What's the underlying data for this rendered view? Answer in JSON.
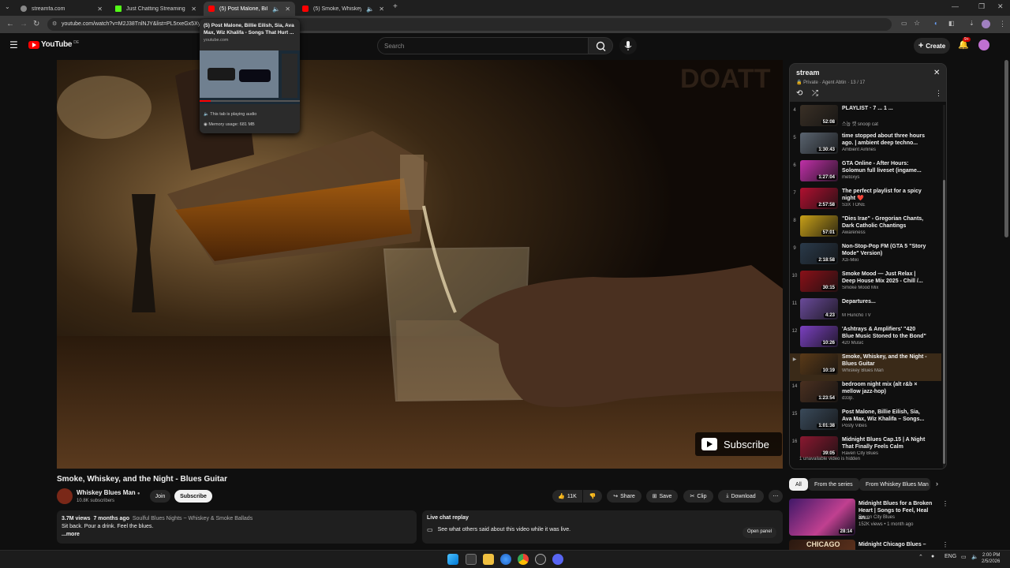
{
  "browser": {
    "tabs": [
      {
        "title": "streamfa.com",
        "color": "#888888"
      },
      {
        "title": "Just Chatting Streaming - Live",
        "color": "#53fc18"
      },
      {
        "title": "(5) Post Malone, Billie Eilish",
        "color": "#ff0000"
      },
      {
        "title": "(5) Smoke, Whiskey, and the",
        "color": "#ff0000"
      }
    ],
    "url": "youtube.com/watch?v=M2J38TnlNJY&list=PL5rxeGx5Xy"
  },
  "hover_card": {
    "title": "(5) Post Malone, Billie Eilish, Sia, Ava Max, Wiz Khalifa - Songs That Hurt ...",
    "domain": "youtube.com",
    "audio": "This tab is playing audio",
    "memory": "Memory usage: 681 MB"
  },
  "masthead": {
    "logo": "YouTube",
    "region": "DE",
    "search_placeholder": "Search",
    "create_label": "Create",
    "notif_count": "9+"
  },
  "video": {
    "watermark": "DOATT",
    "subscribe_overlay": "Subscribe",
    "title": "Smoke, Whiskey, and the Night - Blues Guitar",
    "channel": "Whiskey Blues Man",
    "subscribers": "10.8K subscribers",
    "join_label": "Join",
    "subscribe_label": "Subscribe",
    "likes": "11K",
    "share_label": "Share",
    "save_label": "Save",
    "clip_label": "Clip",
    "download_label": "Download"
  },
  "description": {
    "views": "3.7M views",
    "age": "7 months ago",
    "tags": "Soulful Blues Nights ~ Whiskey & Smoke Ballads",
    "text": "Sit back. Pour a drink. Feel the blues.",
    "more": "...more"
  },
  "chat_replay": {
    "title": "Live chat replay",
    "text": "See what others said about this video while it was live.",
    "button": "Open panel"
  },
  "playlist": {
    "title": "stream",
    "meta": "Private · Agent Abtin · 13 / 17",
    "items": [
      {
        "idx": "4",
        "title": "PLAYLIST · 7 ... 1 ...",
        "channel": "스눕 캣 snoop cat",
        "dur": "52:08",
        "color": "#3a3026"
      },
      {
        "idx": "5",
        "title": "time stopped about three hours ago. | ambient deep techno...",
        "channel": "Ambient Airlines",
        "dur": "1:30:43",
        "color": "#5a6470"
      },
      {
        "idx": "6",
        "title": "GTA Online - After Hours: Solomun full liveset (ingame...",
        "channel": "metoxys",
        "dur": "1:27:04",
        "color": "#c030a8"
      },
      {
        "idx": "7",
        "title": "The perfect playlist for a spicy night ❤️",
        "channel": "S3X TONE",
        "dur": "2:57:58",
        "color": "#b01030"
      },
      {
        "idx": "8",
        "title": "\"Dies Irae\" - Gregorian Chants, Dark Catholic Chantings",
        "channel": "Awareness",
        "dur": "57:01",
        "color": "#c8a018"
      },
      {
        "idx": "9",
        "title": "Non-Stop-Pop FM (GTA 5 \"Story Mode\" Version)",
        "channel": "Xzi-Mixi",
        "dur": "2:18:58",
        "color": "#2a3a4a"
      },
      {
        "idx": "10",
        "title": "Smoke Mood — Just Relax | Deep House Mix 2025 - Chill /...",
        "channel": "Smoke Mood Mix",
        "dur": "30:15",
        "color": "#8a1018"
      },
      {
        "idx": "11",
        "title": "Departures...",
        "channel": "M Huncho TV",
        "dur": "4:23",
        "color": "#6a4a9a"
      },
      {
        "idx": "12",
        "title": "'Ashtrays & Amplifiers' \"420 Blue Music Stoned to the Bond\"",
        "channel": "420 Music",
        "dur": "10:26",
        "color": "#7a40c0"
      },
      {
        "idx": "▶",
        "title": "Smoke, Whiskey, and the Night - Blues Guitar",
        "channel": "Whiskey Blues Man",
        "dur": "10:19",
        "color": "#5a3a18"
      },
      {
        "idx": "14",
        "title": "bedroom night mix (alt r&b × mellow jazz-hop)",
        "channel": "d33p.",
        "dur": "1:23:54",
        "color": "#4a3020"
      },
      {
        "idx": "15",
        "title": "Post Malone, Billie Eilish, Sia, Ava Max, Wiz Khalifa – Songs...",
        "channel": "Posty Vibes",
        "dur": "1:01:38",
        "color": "#3a4a5a"
      },
      {
        "idx": "16",
        "title": "Midnight Blues Cap.15 | A Night That Finally Feels Calm",
        "channel": "Raven City Blues",
        "dur": "39:05",
        "color": "#8a1830"
      }
    ],
    "hidden_note": "1 unavailable video is hidden"
  },
  "chips": [
    "All",
    "From the series",
    "From Whiskey Blues Man"
  ],
  "recommendations": [
    {
      "title": "Midnight Blues for a Broken Heart | Songs to Feel, Heal an...",
      "channel": "Raven City Blues",
      "meta": "152K views • 1 month ago",
      "dur": "28:14",
      "color": "#6a2a80"
    },
    {
      "title": "Midnight Chicago Blues –",
      "channel": "",
      "meta": "",
      "dur": "",
      "color": "#402418"
    }
  ],
  "taskbar": {
    "lang": "ENG",
    "time": "2:00 PM",
    "date": "2/5/2026"
  },
  "colors": {
    "yt_red": "#ff0000",
    "accent_blue": "#3ea6ff",
    "bg": "#0f0f0f"
  }
}
